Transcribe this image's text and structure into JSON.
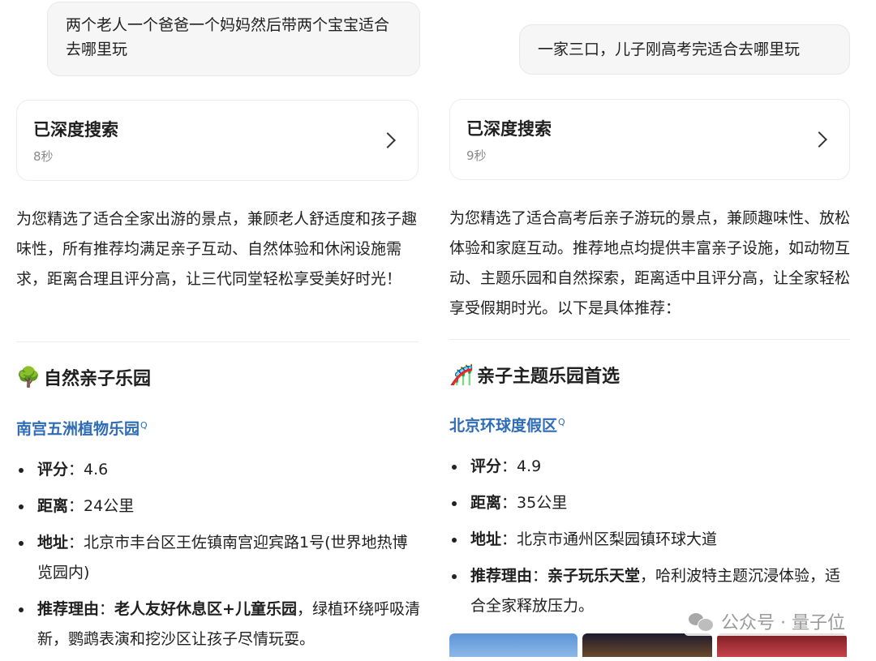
{
  "left": {
    "user_message": "两个老人一个爸爸一个妈妈然后带两个宝宝适合去哪里玩",
    "search": {
      "title": "已深度搜索",
      "time": "8秒"
    },
    "summary": "为您精选了适合全家出游的景点，兼顾老人舒适度和孩子趣味性，所有推荐均满足亲子互动、自然体验和休闲设施需求，距离合理且评分高，让三代同堂轻松享受美好时光！",
    "section": {
      "icon": "tree-emoji",
      "emoji": "🌳",
      "title": "自然亲子乐园"
    },
    "place": {
      "name": "南宫五洲植物乐园",
      "search_marker": "Q"
    },
    "details": {
      "rating_label": "评分",
      "rating_value": "：4.6",
      "distance_label": "距离",
      "distance_value": "：24公里",
      "address_label": "地址",
      "address_value": "：北京市丰台区王佐镇南宫迎宾路1号(世界地热博览园内)",
      "reason_label": "推荐理由",
      "reason_sep": "：",
      "reason_highlight": "老人友好休息区+儿童乐园",
      "reason_text": "，绿植环绕呼吸清新，鹦鹉表演和挖沙区让孩子尽情玩耍。"
    }
  },
  "right": {
    "user_message": "一家三口，儿子刚高考完适合去哪里玩",
    "search": {
      "title": "已深度搜索",
      "time": "9秒"
    },
    "summary": "为您精选了适合高考后亲子游玩的景点，兼顾趣味性、放松体验和家庭互动。推荐地点均提供丰富亲子设施，如动物互动、主题乐园和自然探索，距离适中且评分高，让全家轻松享受假期时光。以下是具体推荐：",
    "section": {
      "icon": "roller-coaster-emoji",
      "emoji": "🎢",
      "title": "亲子主题乐园首选"
    },
    "place": {
      "name": "北京环球度假区",
      "search_marker": "Q"
    },
    "details": {
      "rating_label": "评分",
      "rating_value": "：4.9",
      "distance_label": "距离",
      "distance_value": "：35公里",
      "address_label": "地址",
      "address_value": "：北京市通州区梨园镇环球大道",
      "reason_label": "推荐理由",
      "reason_sep": "：",
      "reason_highlight": "亲子玩乐天堂",
      "reason_text": "，哈利波特主题沉浸体验，适合全家释放压力。"
    }
  },
  "watermark": {
    "text": "公众号 · 量子位",
    "icon": "wechat-icon"
  },
  "colors": {
    "link": "#2f6cb8",
    "bubble_bg": "#f6f6f6",
    "muted": "#8a8a8a"
  }
}
